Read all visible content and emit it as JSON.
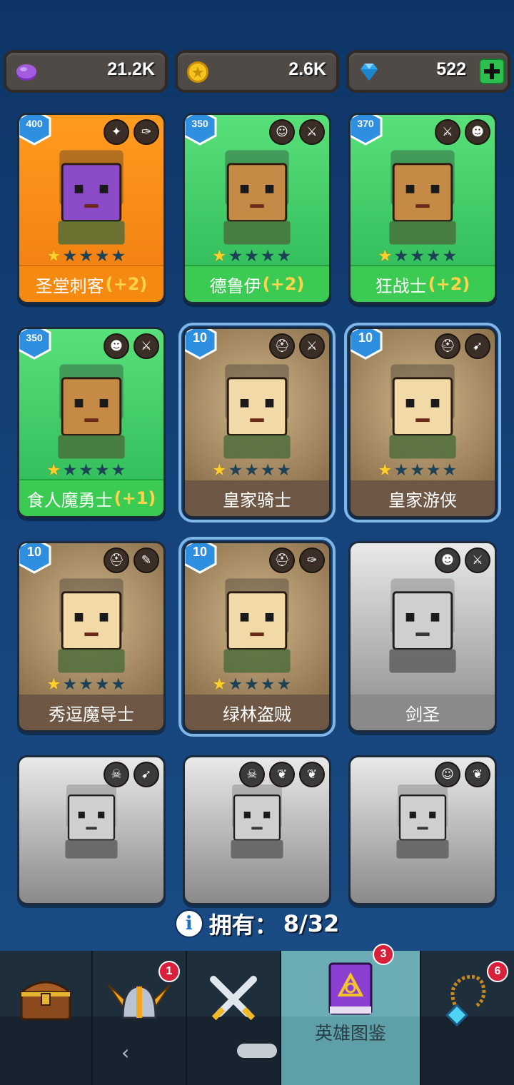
{
  "currencies": [
    {
      "name": "purple-gems",
      "value": "21.2K",
      "color": "#9b4bd6"
    },
    {
      "name": "gold-coins",
      "value": "2.6K",
      "color": "#f4c21c"
    },
    {
      "name": "diamonds",
      "value": "522",
      "color": "#3ab3f0",
      "has_plus": true
    }
  ],
  "heroes": [
    {
      "name": "圣堂刺客",
      "bonus": "(+2)",
      "level": "400",
      "stars": 1,
      "theme": "orange",
      "icons": [
        "wings-icon",
        "dagger-icon"
      ],
      "owned": true
    },
    {
      "name": "德鲁伊",
      "bonus": "(+2)",
      "level": "350",
      "stars": 1,
      "theme": "green",
      "icons": [
        "druid-face-icon",
        "sword-icon"
      ],
      "owned": true
    },
    {
      "name": "狂战士",
      "bonus": "(+2)",
      "level": "370",
      "stars": 1,
      "theme": "green",
      "icons": [
        "sword-icon",
        "orc-face-icon"
      ],
      "owned": true
    },
    {
      "name": "食人魔勇士",
      "bonus": "(+1)",
      "level": "350",
      "stars": 1,
      "theme": "green",
      "icons": [
        "orc-face-icon",
        "sword-icon"
      ],
      "owned": true
    },
    {
      "name": "皇家骑士",
      "bonus": "",
      "level": "10",
      "stars": 1,
      "theme": "brown",
      "icons": [
        "helmet-icon",
        "sword-icon"
      ],
      "owned": true,
      "selected": true
    },
    {
      "name": "皇家游侠",
      "bonus": "",
      "level": "10",
      "stars": 1,
      "theme": "brown",
      "icons": [
        "helmet-icon",
        "bow-icon"
      ],
      "owned": true,
      "selected": true
    },
    {
      "name": "秀逗魔导士",
      "bonus": "",
      "level": "10",
      "stars": 1,
      "theme": "brown",
      "icons": [
        "helmet-icon",
        "wand-icon"
      ],
      "owned": true
    },
    {
      "name": "绿林盗贼",
      "bonus": "",
      "level": "10",
      "stars": 1,
      "theme": "brown",
      "icons": [
        "helmet-icon",
        "dagger-icon"
      ],
      "owned": true,
      "selected": true
    },
    {
      "name": "剑圣",
      "bonus": "",
      "level": "",
      "stars": 0,
      "theme": "gray",
      "icons": [
        "orc-face-icon",
        "sword-icon"
      ],
      "owned": false
    },
    {
      "name": "",
      "bonus": "",
      "level": "",
      "stars": 0,
      "theme": "gray",
      "icons": [
        "skull-icon",
        "bow-icon"
      ],
      "owned": false
    },
    {
      "name": "",
      "bonus": "",
      "level": "",
      "stars": 0,
      "theme": "gray",
      "icons": [
        "skull-icon",
        "dragon-icon",
        "dragon-icon"
      ],
      "owned": false
    },
    {
      "name": "",
      "bonus": "",
      "level": "",
      "stars": 0,
      "theme": "gray",
      "icons": [
        "druid-face-icon",
        "dragon-icon"
      ],
      "owned": false
    }
  ],
  "owned_label": "拥有：",
  "owned_count": "8/32",
  "bottom_nav": [
    {
      "id": "chest",
      "label": "",
      "badge": ""
    },
    {
      "id": "helmet",
      "label": "",
      "badge": "1"
    },
    {
      "id": "battle",
      "label": "",
      "badge": ""
    },
    {
      "id": "hero-guide",
      "label": "英雄图鉴",
      "badge": "3",
      "active": true
    },
    {
      "id": "amulet",
      "label": "",
      "badge": "6"
    }
  ]
}
